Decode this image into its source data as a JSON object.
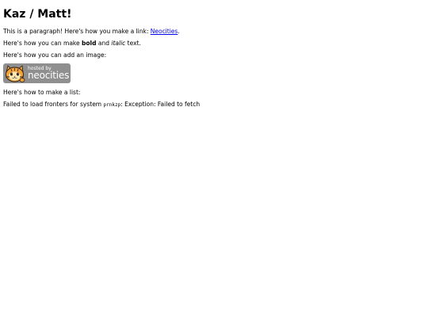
{
  "page": {
    "title": "Kaz / Matt!"
  },
  "paragraph1": {
    "text_before": "This is a paragraph! Here's how you make a link: ",
    "link_text": "Neocities",
    "text_after": "."
  },
  "paragraph2": {
    "text_before": "Here's how you can make ",
    "bold_text": "bold",
    "text_middle": " and ",
    "italic_text": "italic",
    "text_after": " text."
  },
  "paragraph3": {
    "text": "Here's how you can add an image:"
  },
  "badge": {
    "small_text": "hosted by",
    "big_text": "neocities",
    "colors": {
      "background": "#8f8f8f",
      "cat_orange": "#f2a33a",
      "cat_outline": "#2b1a10",
      "cat_face": "#fde7b3"
    }
  },
  "paragraph4": {
    "text": "Here's how to make a list:"
  },
  "paragraph5": {
    "text_before": "Failed to load fronters for system ",
    "code_text": "prnkzp",
    "text_after": ": Exception: Failed to fetch"
  }
}
